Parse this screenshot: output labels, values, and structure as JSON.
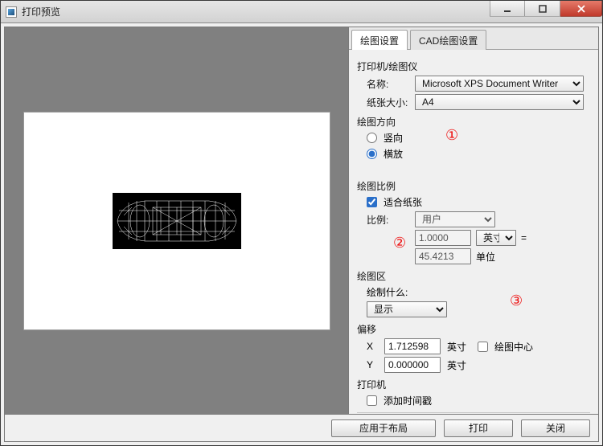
{
  "window": {
    "title": "打印预览"
  },
  "tabs": {
    "plot": "绘图设置",
    "cad": "CAD绘图设置"
  },
  "printer": {
    "section": "打印机/绘图仪",
    "name_label": "名称:",
    "name_value": "Microsoft XPS Document Writer",
    "paper_label": "纸张大小:",
    "paper_value": "A4"
  },
  "orientation": {
    "section": "绘图方向",
    "portrait": "竖向",
    "landscape": "横放"
  },
  "scale": {
    "section": "绘图比例",
    "fit": "适合纸张",
    "ratio_label": "比例:",
    "ratio_value": "用户",
    "top_value": "1.0000",
    "top_unit": "英寸",
    "eq": "=",
    "bottom_value": "45.4213",
    "bottom_unit": "单位"
  },
  "area": {
    "section": "绘图区",
    "what_label": "绘制什么:",
    "what_value": "显示"
  },
  "offset": {
    "section": "偏移",
    "x_label": "X",
    "x_value": "1.712598",
    "x_unit": "英寸",
    "y_label": "Y",
    "y_value": "0.000000",
    "y_unit": "英寸",
    "center": "绘图中心"
  },
  "printer2": {
    "section": "打印机",
    "timestamp": "添加时间戳"
  },
  "footer": {
    "apply": "应用于布局",
    "print": "打印",
    "close": "关闭"
  },
  "annotations": {
    "a1": "①",
    "a2": "②",
    "a3": "③"
  }
}
